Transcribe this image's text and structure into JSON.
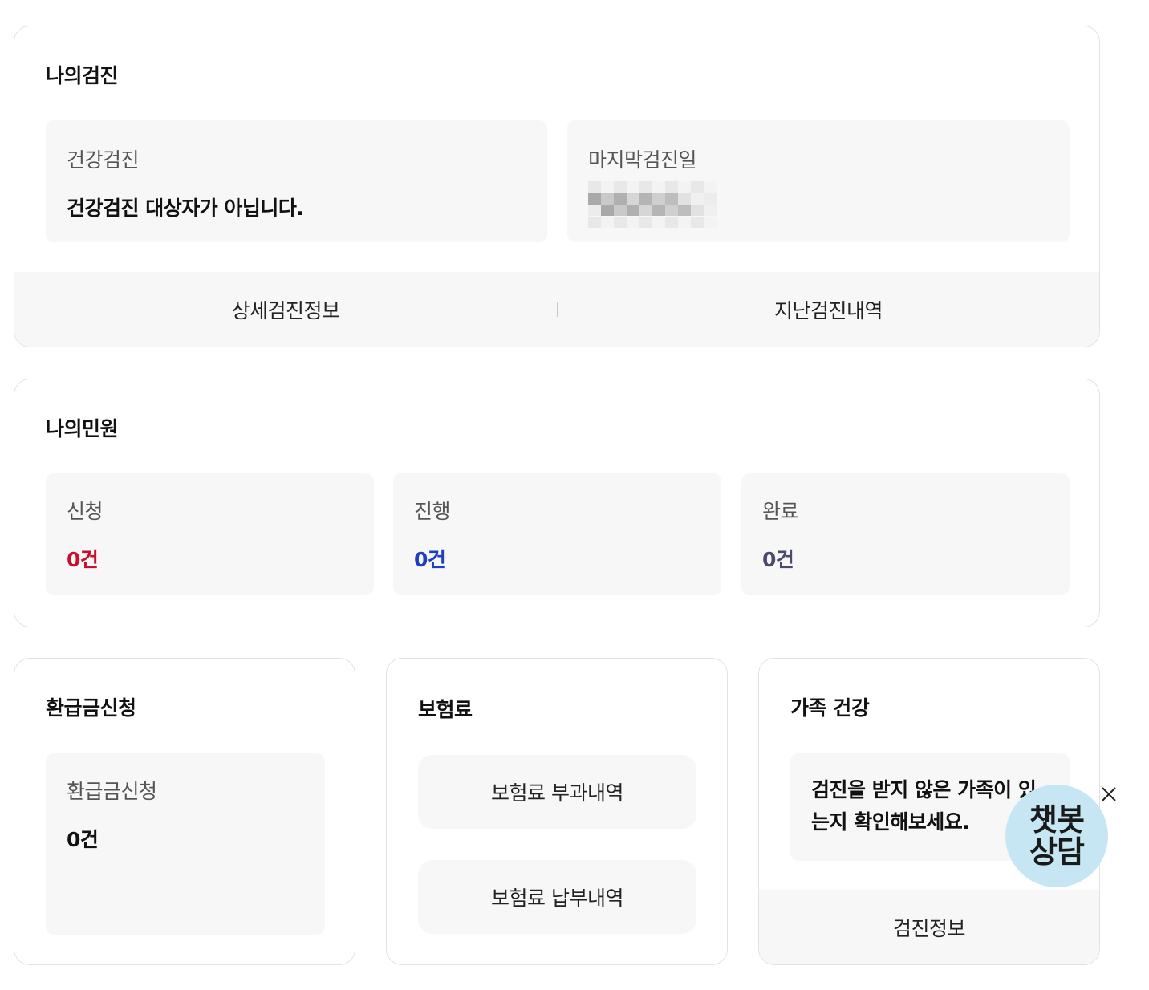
{
  "checkup": {
    "title": "나의검진",
    "health_check": {
      "label": "건강검진",
      "value": "건강검진 대상자가 아닙니다."
    },
    "last_check": {
      "label": "마지막검진일",
      "value_redacted": true
    },
    "footer": {
      "detail_label": "상세검진정보",
      "history_label": "지난검진내역"
    }
  },
  "complaints": {
    "title": "나의민원",
    "items": [
      {
        "label": "신청",
        "value": "0건",
        "color": "#c8102e"
      },
      {
        "label": "진행",
        "value": "0건",
        "color": "#1e3fc0"
      },
      {
        "label": "완료",
        "value": "0건",
        "color": "#4a4a6e"
      }
    ]
  },
  "refund": {
    "title": "환급금신청",
    "label": "환급금신청",
    "value": "0건"
  },
  "insurance": {
    "title": "보험료",
    "charge_label": "보험료 부과내역",
    "payment_label": "보험료 납부내역"
  },
  "family": {
    "title": "가족 건강",
    "message": "검진을 받지 않은 가족이 있는지 확인해보세요.",
    "footer_label": "검진정보"
  },
  "chatbot": {
    "line1": "챗봇",
    "line2": "상담",
    "close_icon": "close-icon",
    "bg_color": "#c6e6f4"
  }
}
